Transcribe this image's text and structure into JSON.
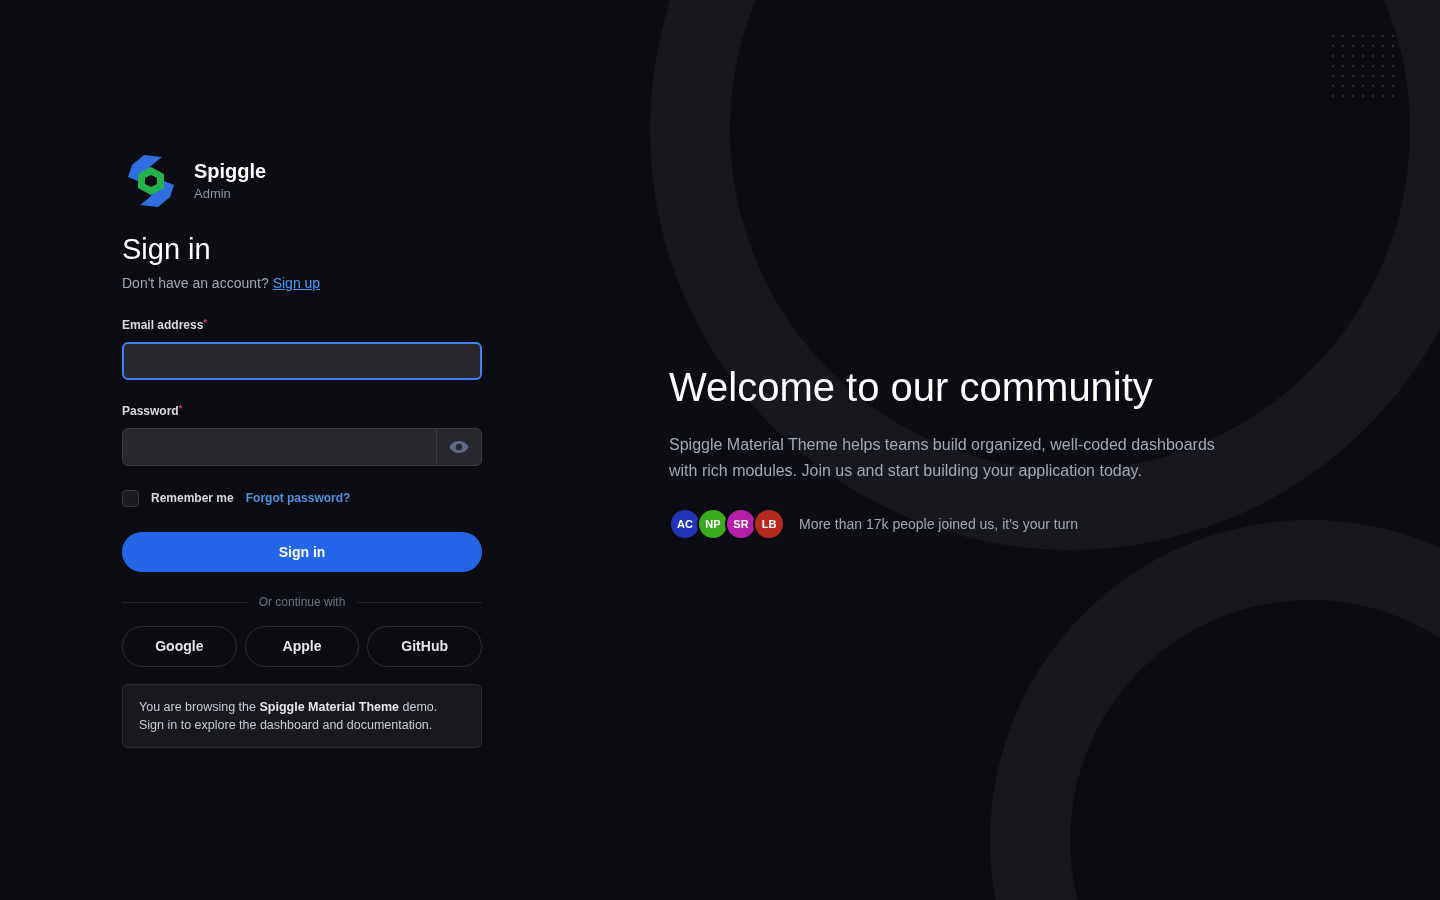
{
  "brand": {
    "name": "Spiggle",
    "subtitle": "Admin"
  },
  "heading": "Sign in",
  "signup_prompt": {
    "text": "Don't have an account?",
    "link": "Sign up"
  },
  "email_field": {
    "label": "Email address",
    "required_mark": "*",
    "focused": true
  },
  "password_field": {
    "label": "Password",
    "required_mark": "*",
    "focused": false
  },
  "remember_me": {
    "label": "Remember me",
    "checked": false
  },
  "forgot_link": "Forgot password?",
  "submit_button": "Sign in",
  "divider_text": "Or continue with",
  "social_buttons": [
    "Google",
    "Apple",
    "GitHub"
  ],
  "notice": "You are browsing the **Spiggle Material Theme** demo. Sign in to explore the dashboard and documentation.",
  "hero": {
    "title": "Welcome to our community",
    "body": "Spiggle Material Theme helps teams build organized, well-coded dashboards with rich modules. Join us and start building your application today.",
    "avatars": [
      {
        "initials": "AC",
        "color": "#2334b8"
      },
      {
        "initials": "NP",
        "color": "#3aaa1e"
      },
      {
        "initials": "SR",
        "color": "#b51fa8"
      },
      {
        "initials": "LB",
        "color": "#b52a20"
      }
    ],
    "caption": "More than 17k people joined us, it's your turn"
  }
}
